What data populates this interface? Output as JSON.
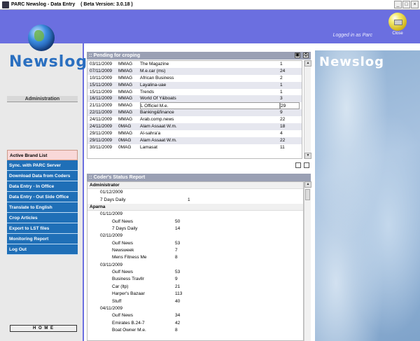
{
  "window": {
    "title": "PARC Newslog - Data Entry",
    "version": "( Beta Version:  3.0.18 )",
    "controls": [
      "_",
      "□",
      "×"
    ]
  },
  "header": {
    "logged_in": "Logged in as Parc",
    "close_label": "Close"
  },
  "sidebar": {
    "logo": "Newslog",
    "section": "Administration",
    "items": [
      {
        "label": "Active Brand List"
      },
      {
        "label": "Sync. with PARC Server"
      },
      {
        "label": "Download Data from Coders"
      },
      {
        "label": "Data Entry - In Office"
      },
      {
        "label": "Data Entry - Out Side Office"
      },
      {
        "label": "Translate to English"
      },
      {
        "label": "Crop Articles"
      },
      {
        "label": "Export to LST files"
      },
      {
        "label": "Monitoring Report"
      },
      {
        "label": "Log Out"
      }
    ],
    "home": "H O M E"
  },
  "pending": {
    "title": ":: Pending for croping",
    "rows": [
      [
        "03/11/2009",
        "MMAG",
        "The Magazine",
        "1"
      ],
      [
        "07/11/2009",
        "MMAG",
        "M.e.car (ms)",
        "24"
      ],
      [
        "10/11/2009",
        "MMAG",
        "African Business",
        "2"
      ],
      [
        "15/11/2009",
        "MMAG",
        "Layalina-uae",
        "1"
      ],
      [
        "15/11/2009",
        "MMAG",
        "Trends",
        "1"
      ],
      [
        "16/11/2009",
        "MMAG",
        "World Of Y&boats",
        "3"
      ],
      [
        "21/11/2009",
        "MMAG",
        "L Officiel M.e.",
        "29"
      ],
      [
        "22/11/2009",
        "MMAG",
        "Banking&finance",
        "9"
      ],
      [
        "24/11/2009",
        "MMAG",
        "Arab.comp.news",
        "22"
      ],
      [
        "24/11/2009",
        "0MAG",
        "Alam Assaat W.m.",
        "18"
      ],
      [
        "29/11/2009",
        "MMAG",
        "Al-sahra'a",
        "4"
      ],
      [
        "29/11/2009",
        "0MAG",
        "Alam Assaat W.m.",
        "22"
      ],
      [
        "30/11/2009",
        "0MAG",
        "Lamasat",
        "11"
      ]
    ]
  },
  "status": {
    "title": ":: Coder's Status Report",
    "rows": [
      {
        "type": "coder",
        "text": "Administrator"
      },
      {
        "type": "date",
        "text": "01/12/2009"
      },
      {
        "type": "admin-item",
        "name": "7 Days Daily",
        "value": "1"
      },
      {
        "type": "coder",
        "text": "Aparna"
      },
      {
        "type": "date",
        "text": "01/11/2009"
      },
      {
        "type": "item",
        "name": "Gulf News",
        "value": "50"
      },
      {
        "type": "item",
        "name": "7 Days Daily",
        "value": "14"
      },
      {
        "type": "date",
        "text": "02/11/2009"
      },
      {
        "type": "item",
        "name": "Gulf News",
        "value": "53"
      },
      {
        "type": "item",
        "name": "Newsweek",
        "value": "7"
      },
      {
        "type": "item",
        "name": "Mens Fitness Me",
        "value": "8"
      },
      {
        "type": "date",
        "text": "03/11/2009"
      },
      {
        "type": "item",
        "name": "Gulf News",
        "value": "53"
      },
      {
        "type": "item",
        "name": "Business Travllr",
        "value": "9"
      },
      {
        "type": "item",
        "name": "Car (ltp)",
        "value": "21"
      },
      {
        "type": "item",
        "name": "Harper's Bazaar",
        "value": "113"
      },
      {
        "type": "item",
        "name": "Stuff",
        "value": "40"
      },
      {
        "type": "date",
        "text": "04/11/2009"
      },
      {
        "type": "item",
        "name": "Gulf News",
        "value": "34"
      },
      {
        "type": "item",
        "name": "Emirates B.24-7",
        "value": "42"
      },
      {
        "type": "item",
        "name": "Boat Owner M.e.",
        "value": "8"
      }
    ]
  },
  "brand_image": {
    "text": "Newslog"
  },
  "colors": {
    "header": "#6b6fe0",
    "menu": "#1f6fb7",
    "panel_title": "#9aa0b4"
  }
}
